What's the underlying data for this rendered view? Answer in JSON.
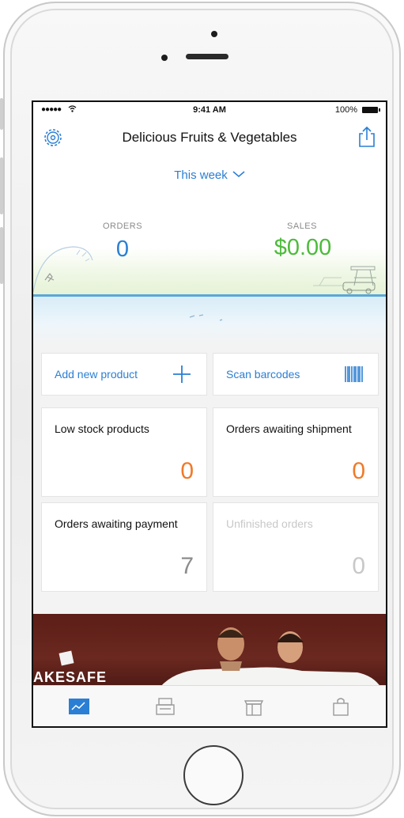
{
  "status_bar": {
    "signal": "●●●●● ",
    "time": "9:41 AM",
    "battery": "100%"
  },
  "nav": {
    "title": "Delicious Fruits & Vegetables",
    "left_icon": "gear-icon",
    "right_icon": "share-icon"
  },
  "period": {
    "label": "This week"
  },
  "stats": {
    "orders_label": "ORDERS",
    "orders_value": "0",
    "sales_label": "SALES",
    "sales_value": "$0.00"
  },
  "actions": {
    "add_product": "Add new product",
    "scan_barcodes": "Scan barcodes"
  },
  "cards": [
    {
      "label": "Low stock products",
      "count": "0"
    },
    {
      "label": "Orders awaiting shipment",
      "count": "0"
    },
    {
      "label": "Orders awaiting payment",
      "count": "7"
    },
    {
      "label": "Unfinished orders",
      "count": "0"
    }
  ],
  "banner": {
    "brand": "AKESAFE"
  },
  "tabs": [
    {
      "icon": "dashboard-chart-icon",
      "active": true
    },
    {
      "icon": "register-icon",
      "active": false
    },
    {
      "icon": "box-icon",
      "active": false
    },
    {
      "icon": "bag-icon",
      "active": false
    }
  ],
  "colors": {
    "accent_blue": "#2a7fd4",
    "sales_green": "#4cbb3a",
    "count_orange": "#f07a2a",
    "count_gray": "#8c8c8c",
    "disabled_gray": "#c8c8c8"
  }
}
